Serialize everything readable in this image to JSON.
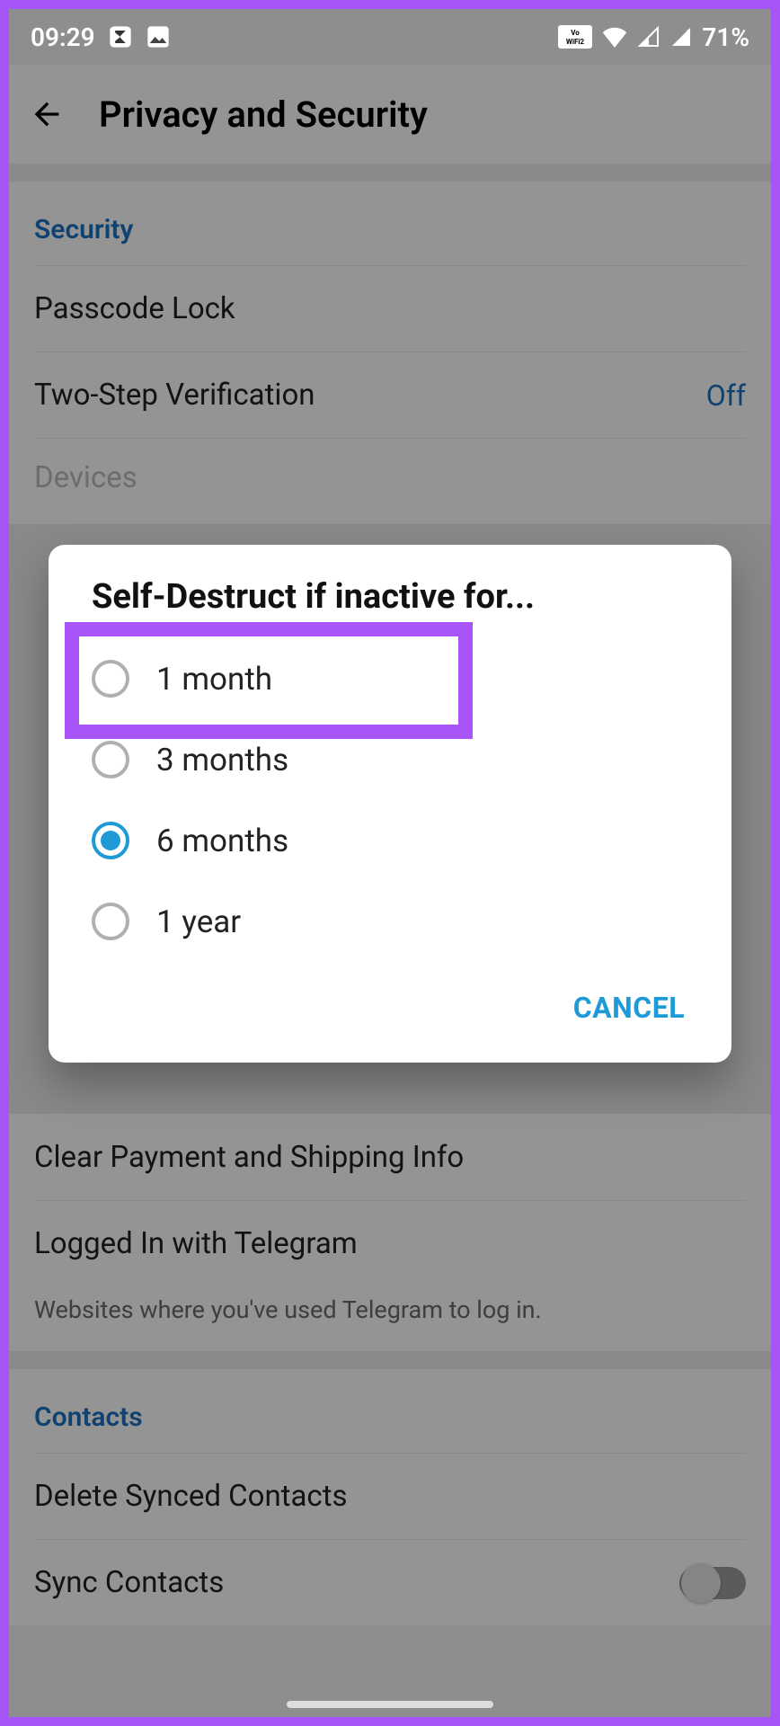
{
  "status": {
    "time": "09:29",
    "battery_text": "71%"
  },
  "appbar": {
    "title": "Privacy and Security"
  },
  "security": {
    "header": "Security",
    "passcode": "Passcode Lock",
    "two_step": "Two-Step Verification",
    "two_step_value": "Off",
    "devices_partial": "Devices"
  },
  "hidden_rows": {
    "payment": "Clear Payment and Shipping Info",
    "logged_in": "Logged In with Telegram",
    "logged_in_sub": "Websites where you've used Telegram to log in."
  },
  "contacts": {
    "header": "Contacts",
    "delete": "Delete Synced Contacts",
    "sync": "Sync Contacts"
  },
  "dialog": {
    "title": "Self-Destruct if inactive for...",
    "options": [
      {
        "label": "1 month",
        "selected": false
      },
      {
        "label": "3 months",
        "selected": false
      },
      {
        "label": "6 months",
        "selected": true
      },
      {
        "label": "1 year",
        "selected": false
      }
    ],
    "cancel": "CANCEL"
  }
}
